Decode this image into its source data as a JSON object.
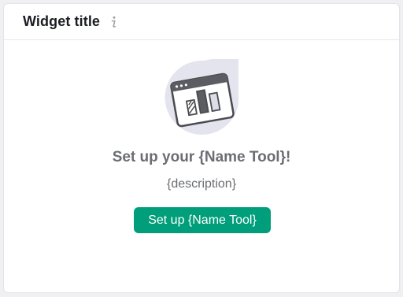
{
  "widget": {
    "title": "Widget title",
    "info_icon": "info-icon"
  },
  "empty_state": {
    "illustration_icon": "app-window-chart-icon",
    "title": "Set up your {Name Tool}!",
    "description": "{description}",
    "button_label": "Set up {Name Tool}"
  },
  "colors": {
    "accent": "#009e7a",
    "title_text": "#1b1d22",
    "muted_text": "#6b6d72",
    "illustration_bg": "#e4e4ee"
  }
}
